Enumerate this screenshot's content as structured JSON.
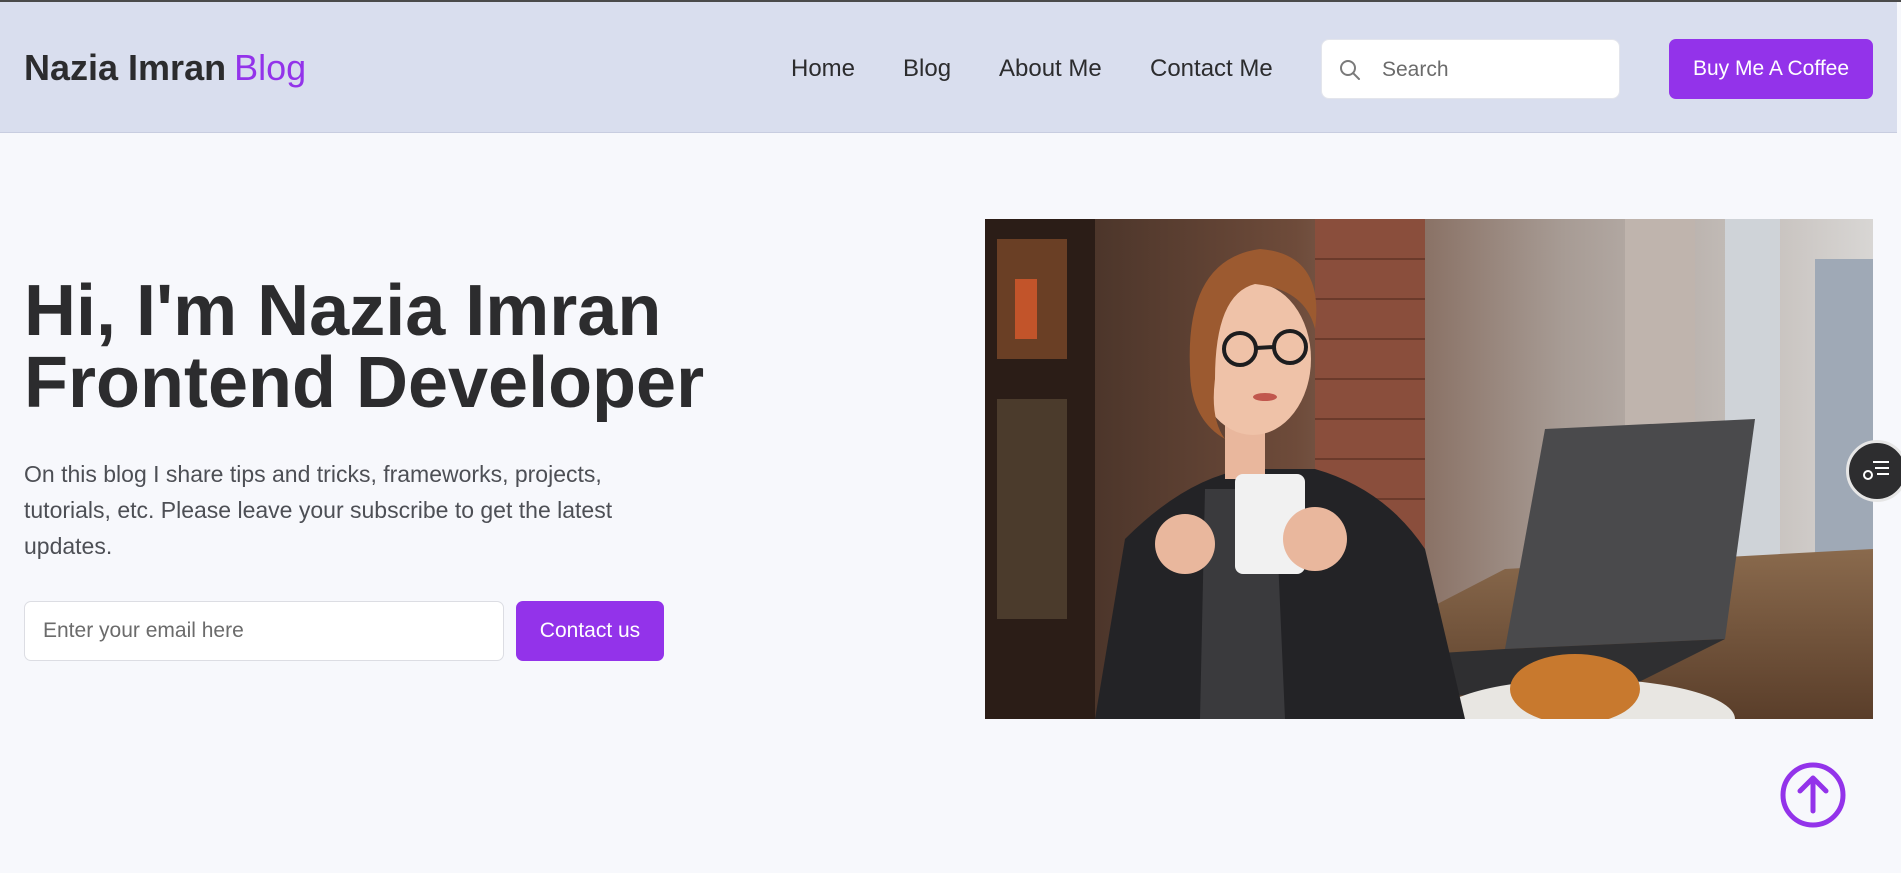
{
  "header": {
    "brand_name": "Nazia Imran",
    "brand_accent": "Blog",
    "nav": {
      "home": "Home",
      "blog": "Blog",
      "about": "About Me",
      "contact": "Contact Me"
    },
    "search": {
      "placeholder": "Search",
      "value": "",
      "icon": "search-icon"
    },
    "coffee_button": "Buy Me A Coffee"
  },
  "hero": {
    "title_line1": "Hi, I'm Nazia Imran",
    "title_line2": "Frontend Developer",
    "description": "On this blog I share tips and tricks, frameworks, projects, tutorials, etc. Please leave your subscribe to get the latest updates.",
    "email_placeholder": "Enter your email here",
    "email_value": "",
    "contact_button": "Contact us"
  },
  "widgets": {
    "side_widget_icon": "reader-menu-icon",
    "scroll_top_icon": "arrow-up-circle-icon"
  },
  "colors": {
    "accent": "#9333ea",
    "header_bg": "#d9deee",
    "page_bg": "#f7f8fc",
    "text_dark": "#2c2c2e"
  }
}
